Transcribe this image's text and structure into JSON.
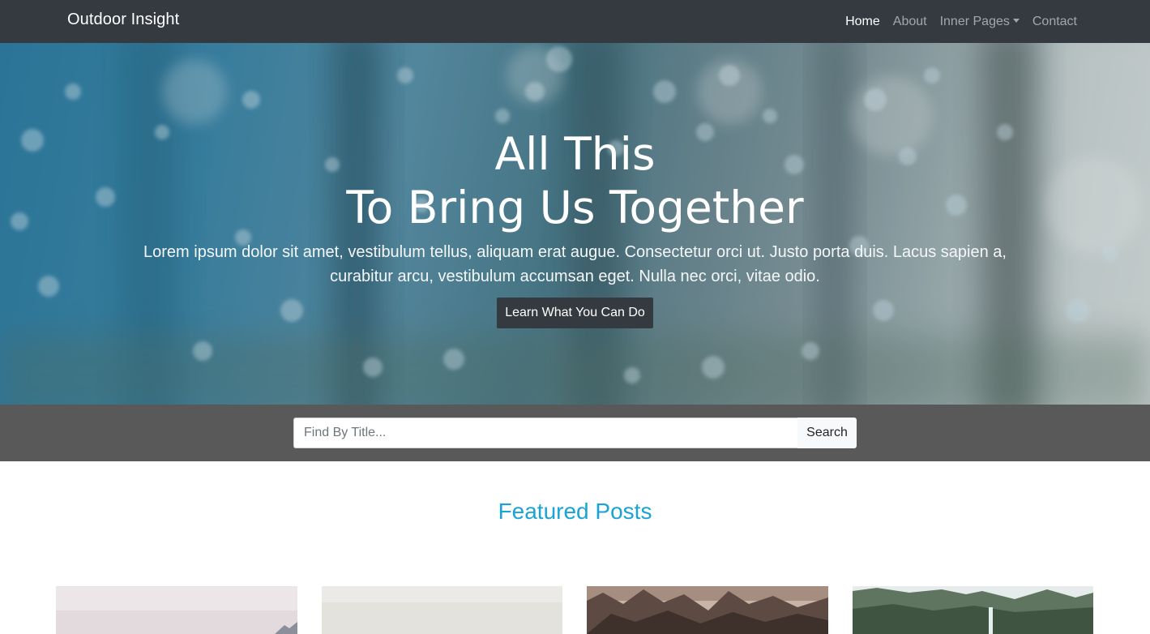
{
  "navbar": {
    "brand": "Outdoor Insight",
    "links": [
      {
        "label": "Home"
      },
      {
        "label": "About"
      },
      {
        "label": "Inner Pages"
      },
      {
        "label": "Contact"
      }
    ]
  },
  "hero": {
    "title_line1": "All This",
    "title_line2": "To Bring Us Together",
    "lead": "Lorem ipsum dolor sit amet, vestibulum tellus, aliquam erat augue. Consectetur orci ut. Justo porta duis. Lacus sapien a, curabitur arcu, vestibulum accumsan eget. Nulla nec orci, vitae odio.",
    "button_label": "Learn What You Can Do"
  },
  "search": {
    "placeholder": "Find By Title...",
    "button_label": "Search"
  },
  "featured": {
    "title": "Featured Posts",
    "cards": [
      {
        "image": "snowy-mountain-photo"
      },
      {
        "image": "misty-sky-photo"
      },
      {
        "image": "rocky-peaks-photo"
      },
      {
        "image": "waterfall-cliffs-photo"
      }
    ]
  },
  "colors": {
    "navbar": "#343a40",
    "accent": "#1aa3d6",
    "search_band": "#595959"
  }
}
